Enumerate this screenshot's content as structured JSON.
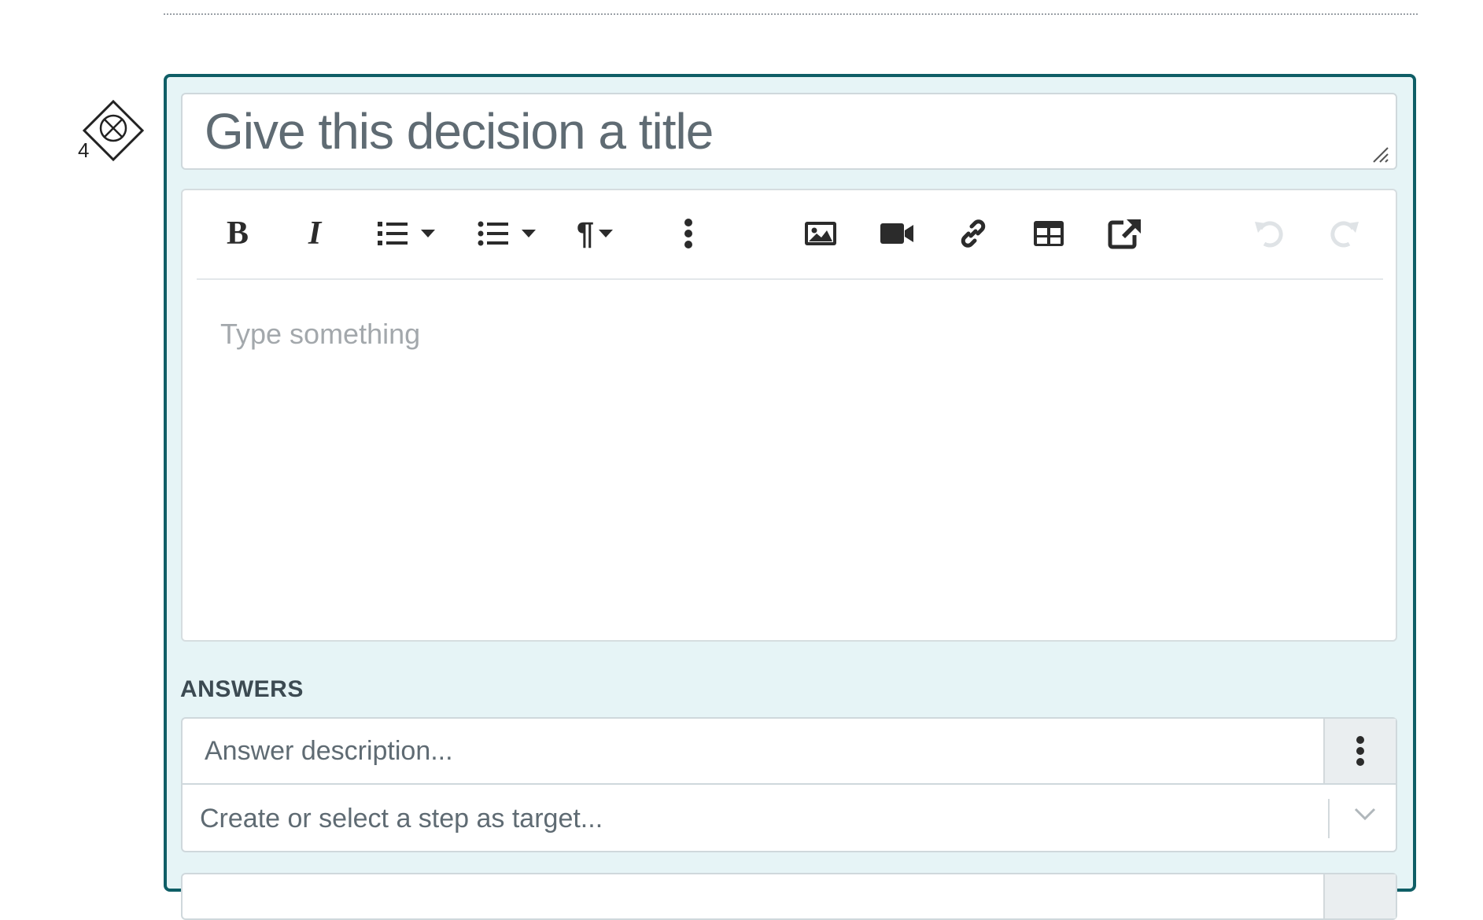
{
  "step": {
    "number": "4"
  },
  "decision": {
    "title_placeholder": "Give this decision a title"
  },
  "toolbar": {
    "bold": "B",
    "italic": "I",
    "buttons": [
      "bold",
      "italic",
      "ordered-list",
      "ordered-list-dropdown",
      "unordered-list",
      "unordered-list-dropdown",
      "paragraph-format",
      "more",
      "insert-image",
      "insert-video",
      "insert-link",
      "insert-table",
      "insert-external-link",
      "undo",
      "redo"
    ],
    "paragraph": "¶"
  },
  "editor": {
    "placeholder": "Type something"
  },
  "answers": {
    "label": "ANSWERS",
    "items": [
      {
        "description_placeholder": "Answer description...",
        "target_placeholder": "Create or select a step as target..."
      }
    ]
  },
  "colors": {
    "card_border": "#0f5e66",
    "card_bg": "#e6f4f6",
    "placeholder_text": "#5f6b73"
  }
}
